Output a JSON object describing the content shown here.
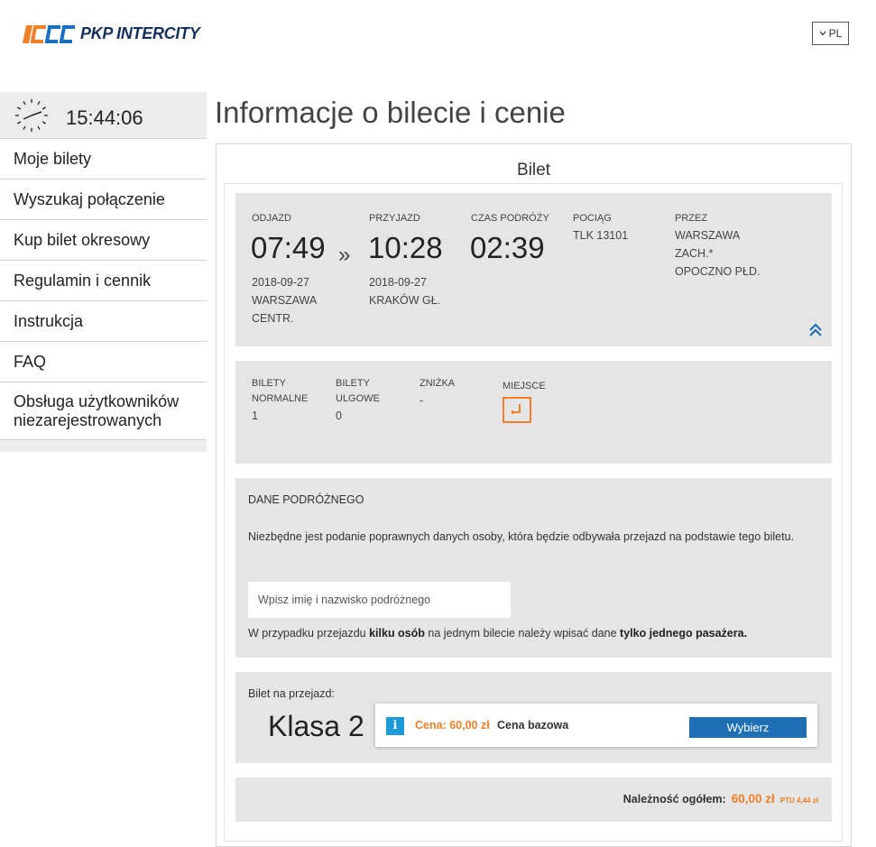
{
  "header": {
    "logo_text": "PKP INTERCITY",
    "language": "PL"
  },
  "sidebar": {
    "clock": "15:44:06",
    "items": [
      {
        "label": "Moje bilety"
      },
      {
        "label": "Wyszukaj połączenie"
      },
      {
        "label": "Kup bilet okresowy"
      },
      {
        "label": "Regulamin i cennik"
      },
      {
        "label": "Instrukcja"
      },
      {
        "label": "FAQ"
      },
      {
        "label": "Obsługa użytkowników niezarejestrowanych"
      }
    ]
  },
  "main": {
    "title": "Informacje o bilecie i cenie",
    "section_title": "Bilet",
    "journey": {
      "departure_label": "ODJAZD",
      "departure_time": "07:49",
      "departure_date": "2018-09-27",
      "departure_station_1": "WARSZAWA",
      "departure_station_2": "CENTR.",
      "arrow": "»",
      "arrival_label": "PRZYJAZD",
      "arrival_time": "10:28",
      "arrival_date": "2018-09-27",
      "arrival_station": "KRAKÓW GŁ.",
      "duration_label": "CZAS PODRÓŻY",
      "duration": "02:39",
      "train_label": "POCIĄG",
      "train": "TLK 13101",
      "via_label": "PRZEZ",
      "via_1": "WARSZAWA",
      "via_2": "ZACH.*",
      "via_3": "OPOCZNO PŁD."
    },
    "tickets": {
      "normal_label_1": "BILETY",
      "normal_label_2": "NORMALNE",
      "normal_value": "1",
      "reduced_label_1": "BILETY",
      "reduced_label_2": "ULGOWE",
      "reduced_value": "0",
      "discount_label": "ZNIŻKA",
      "discount_value": "-",
      "seat_label": "MIEJSCE"
    },
    "passenger": {
      "title": "DANE PODRÓŻNEGO",
      "description": "Niezbędne jest podanie poprawnych danych osoby, która będzie odbywała przejazd na podstawie tego biletu.",
      "placeholder": "Wpisz imię i nazwisko podróżnego",
      "note_1": "W przypadku przejazdu ",
      "note_bold_1": "kilku osób",
      "note_2": " na jednym bilecie należy wpisać dane ",
      "note_bold_2": "tylko jednego pasażera."
    },
    "class_offer": {
      "label": "Bilet na przejazd:",
      "class_name": "Klasa 2",
      "price": "Cena: 60,00 zł",
      "price_desc": "Cena bazowa",
      "button": "Wybierz"
    },
    "total": {
      "label": "Należność ogółem:",
      "amount": "60,00 zł",
      "vat": "PTU 4,44 zł"
    }
  },
  "colors": {
    "accent_orange": "#f07f27",
    "button_blue": "#1f6fb5",
    "info_blue": "#1a9ad6",
    "panel_gray": "#e5e5e5",
    "logo_navy": "#14305c"
  }
}
